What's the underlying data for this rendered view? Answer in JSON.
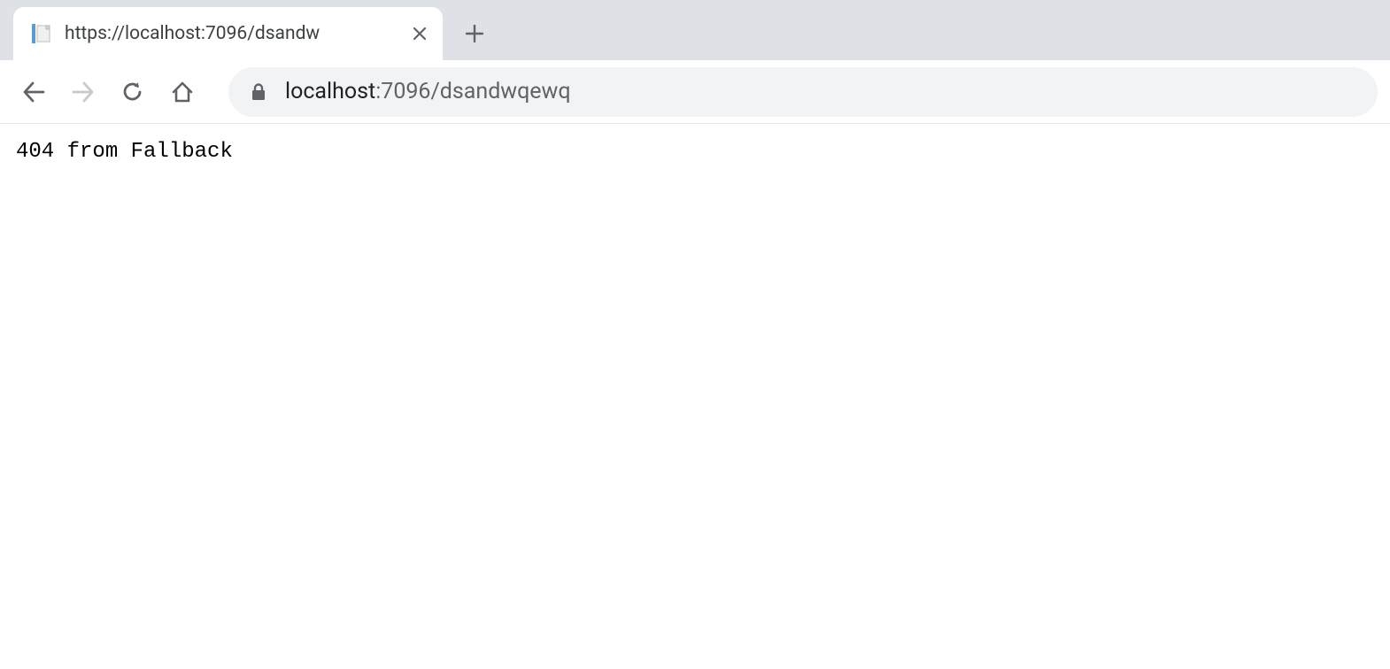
{
  "tab": {
    "title": "https://localhost:7096/dsandw"
  },
  "address": {
    "host": "localhost",
    "path": ":7096/dsandwqewq"
  },
  "page": {
    "body_text": "404 from Fallback"
  }
}
